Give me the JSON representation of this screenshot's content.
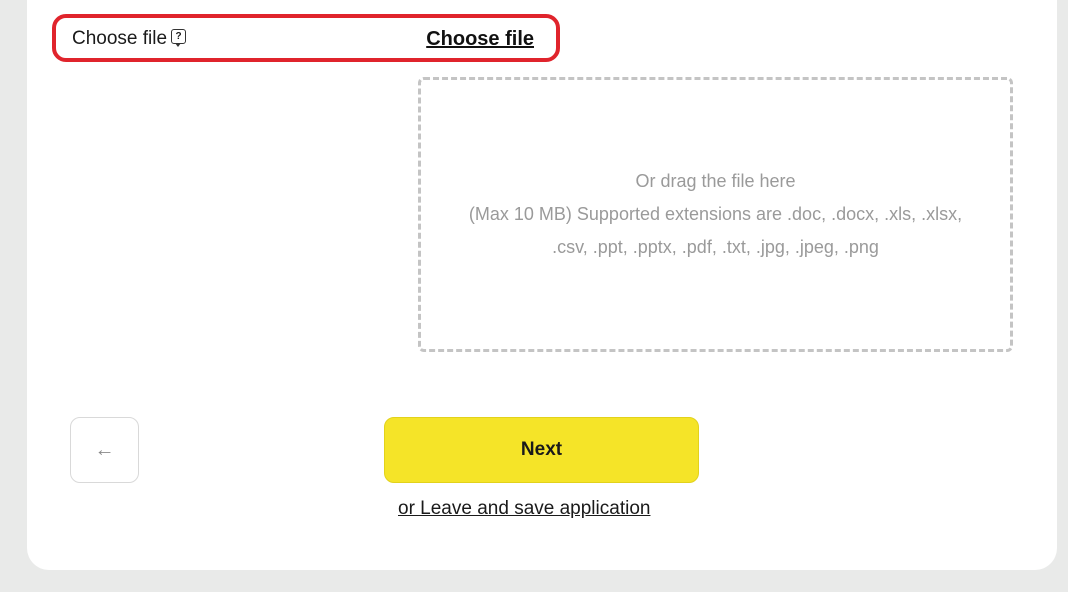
{
  "file_field": {
    "label": "Choose file",
    "help_icon": "question-icon",
    "choose_link": "Choose file"
  },
  "dropzone": {
    "line1": "Or drag the file here",
    "line2": "(Max 10 MB) Supported extensions are .doc, .docx, .xls, .xlsx, .csv, .ppt, .pptx, .pdf, .txt, .jpg, .jpeg, .png"
  },
  "actions": {
    "back_icon": "←",
    "next_label": "Next",
    "leave_label": "or Leave and save application"
  },
  "colors": {
    "highlight": "#e0242c",
    "primary": "#f5e428",
    "background": "#e9eae9"
  }
}
